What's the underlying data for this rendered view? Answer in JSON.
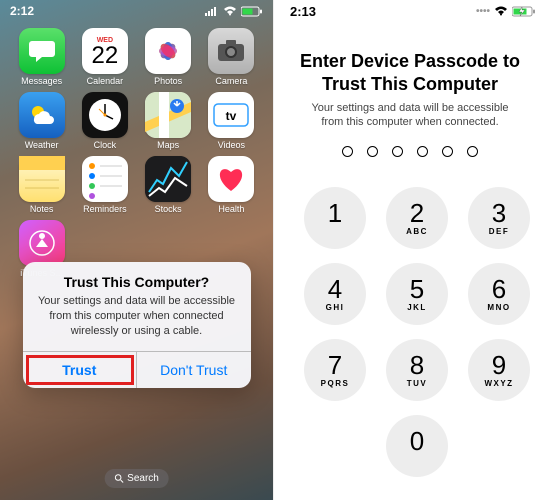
{
  "left": {
    "time": "2:12",
    "apps": [
      {
        "label": "Messages"
      },
      {
        "label": "Calendar",
        "dow": "WED",
        "dnum": "22"
      },
      {
        "label": "Photos"
      },
      {
        "label": "Camera"
      },
      {
        "label": "Weather"
      },
      {
        "label": "Clock"
      },
      {
        "label": "Maps"
      },
      {
        "label": "Videos"
      },
      {
        "label": "Notes"
      },
      {
        "label": "Reminders"
      },
      {
        "label": "Stocks"
      },
      {
        "label": "Health"
      },
      {
        "label": "iTunes S..."
      }
    ],
    "dialog": {
      "title": "Trust This Computer?",
      "body": "Your settings and data will be accessible from this computer when connected wirelessly or using a cable.",
      "trust": "Trust",
      "dont": "Don't Trust"
    },
    "search": "Search"
  },
  "right": {
    "time": "2:13",
    "title": "Enter Device Passcode to Trust This Computer",
    "body": "Your settings and data will be accessible from this computer when connected.",
    "keys": [
      {
        "n": "1",
        "l": ""
      },
      {
        "n": "2",
        "l": "ABC"
      },
      {
        "n": "3",
        "l": "DEF"
      },
      {
        "n": "4",
        "l": "GHI"
      },
      {
        "n": "5",
        "l": "JKL"
      },
      {
        "n": "6",
        "l": "MNO"
      },
      {
        "n": "7",
        "l": "PQRS"
      },
      {
        "n": "8",
        "l": "TUV"
      },
      {
        "n": "9",
        "l": "WXYZ"
      },
      {
        "n": "0",
        "l": ""
      }
    ]
  }
}
